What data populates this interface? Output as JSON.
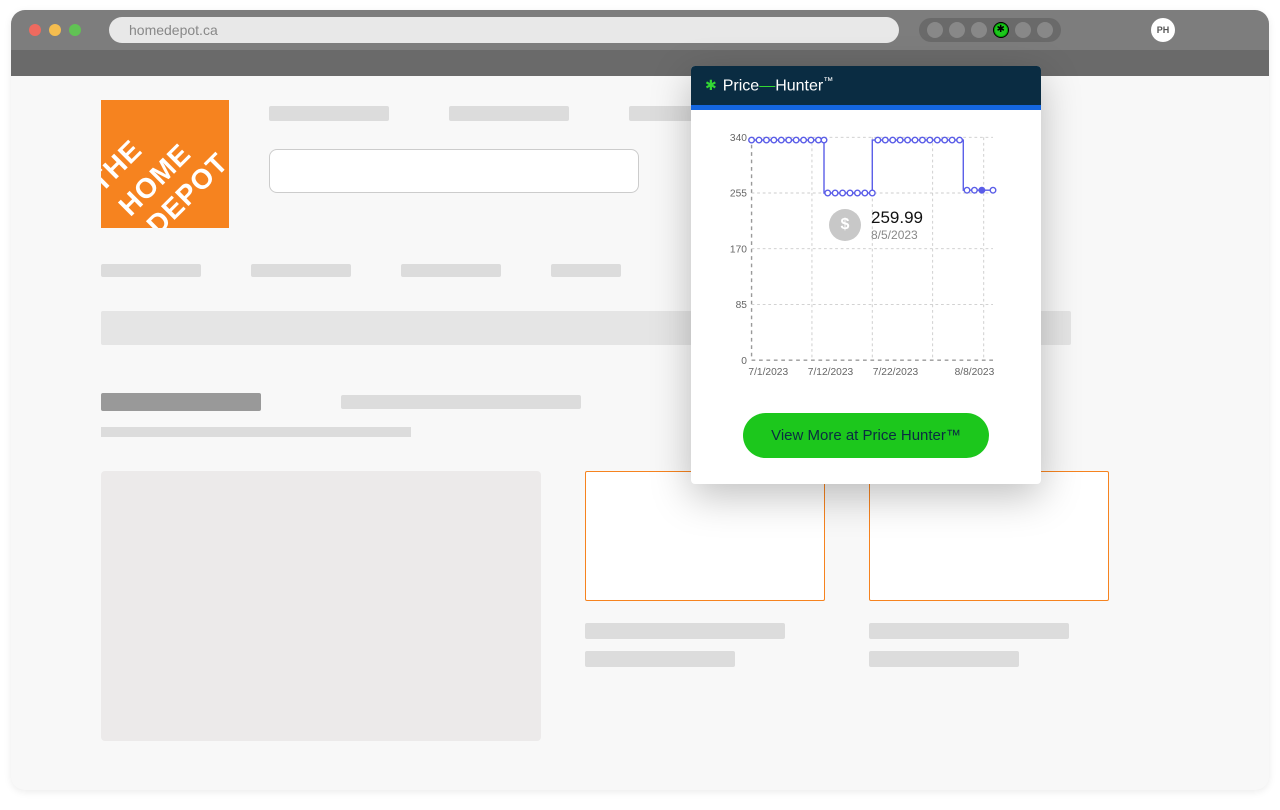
{
  "browser": {
    "url_display": "homedepot.ca",
    "profile_initials": "PH"
  },
  "popup": {
    "brand_pre": "Price",
    "brand_post": "Hunter",
    "tooltip_price": "259.99",
    "tooltip_date": "8/5/2023",
    "cta_label": "View More at Price Hunter™"
  },
  "chart_data": {
    "type": "line",
    "title": "",
    "xlabel": "",
    "ylabel": "",
    "ylim": [
      0,
      340
    ],
    "y_ticks": [
      0,
      85,
      170,
      255,
      340
    ],
    "x_ticks": [
      "7/1/2023",
      "7/12/2023",
      "7/22/2023",
      "8/8/2023"
    ],
    "series": [
      {
        "name": "price",
        "points": [
          {
            "x": "7/1/2023",
            "y": 335
          },
          {
            "x": "7/2/2023",
            "y": 335
          },
          {
            "x": "7/3/2023",
            "y": 335
          },
          {
            "x": "7/4/2023",
            "y": 335
          },
          {
            "x": "7/5/2023",
            "y": 335
          },
          {
            "x": "7/6/2023",
            "y": 335
          },
          {
            "x": "7/7/2023",
            "y": 335
          },
          {
            "x": "7/8/2023",
            "y": 335
          },
          {
            "x": "7/9/2023",
            "y": 335
          },
          {
            "x": "7/10/2023",
            "y": 335
          },
          {
            "x": "7/11/2023",
            "y": 335
          },
          {
            "x": "7/12/2023",
            "y": 255
          },
          {
            "x": "7/13/2023",
            "y": 255
          },
          {
            "x": "7/14/2023",
            "y": 255
          },
          {
            "x": "7/15/2023",
            "y": 255
          },
          {
            "x": "7/16/2023",
            "y": 255
          },
          {
            "x": "7/17/2023",
            "y": 255
          },
          {
            "x": "7/18/2023",
            "y": 255
          },
          {
            "x": "7/19/2023",
            "y": 335
          },
          {
            "x": "7/20/2023",
            "y": 335
          },
          {
            "x": "7/21/2023",
            "y": 335
          },
          {
            "x": "7/22/2023",
            "y": 335
          },
          {
            "x": "7/23/2023",
            "y": 335
          },
          {
            "x": "7/24/2023",
            "y": 335
          },
          {
            "x": "7/25/2023",
            "y": 335
          },
          {
            "x": "7/26/2023",
            "y": 335
          },
          {
            "x": "7/27/2023",
            "y": 335
          },
          {
            "x": "7/28/2023",
            "y": 335
          },
          {
            "x": "7/29/2023",
            "y": 335
          },
          {
            "x": "7/30/2023",
            "y": 335
          },
          {
            "x": "8/5/2023",
            "y": 259.99
          },
          {
            "x": "8/6/2023",
            "y": 259.99
          },
          {
            "x": "8/7/2023",
            "y": 259.99
          },
          {
            "x": "8/8/2023",
            "y": 259.99
          }
        ]
      }
    ]
  }
}
